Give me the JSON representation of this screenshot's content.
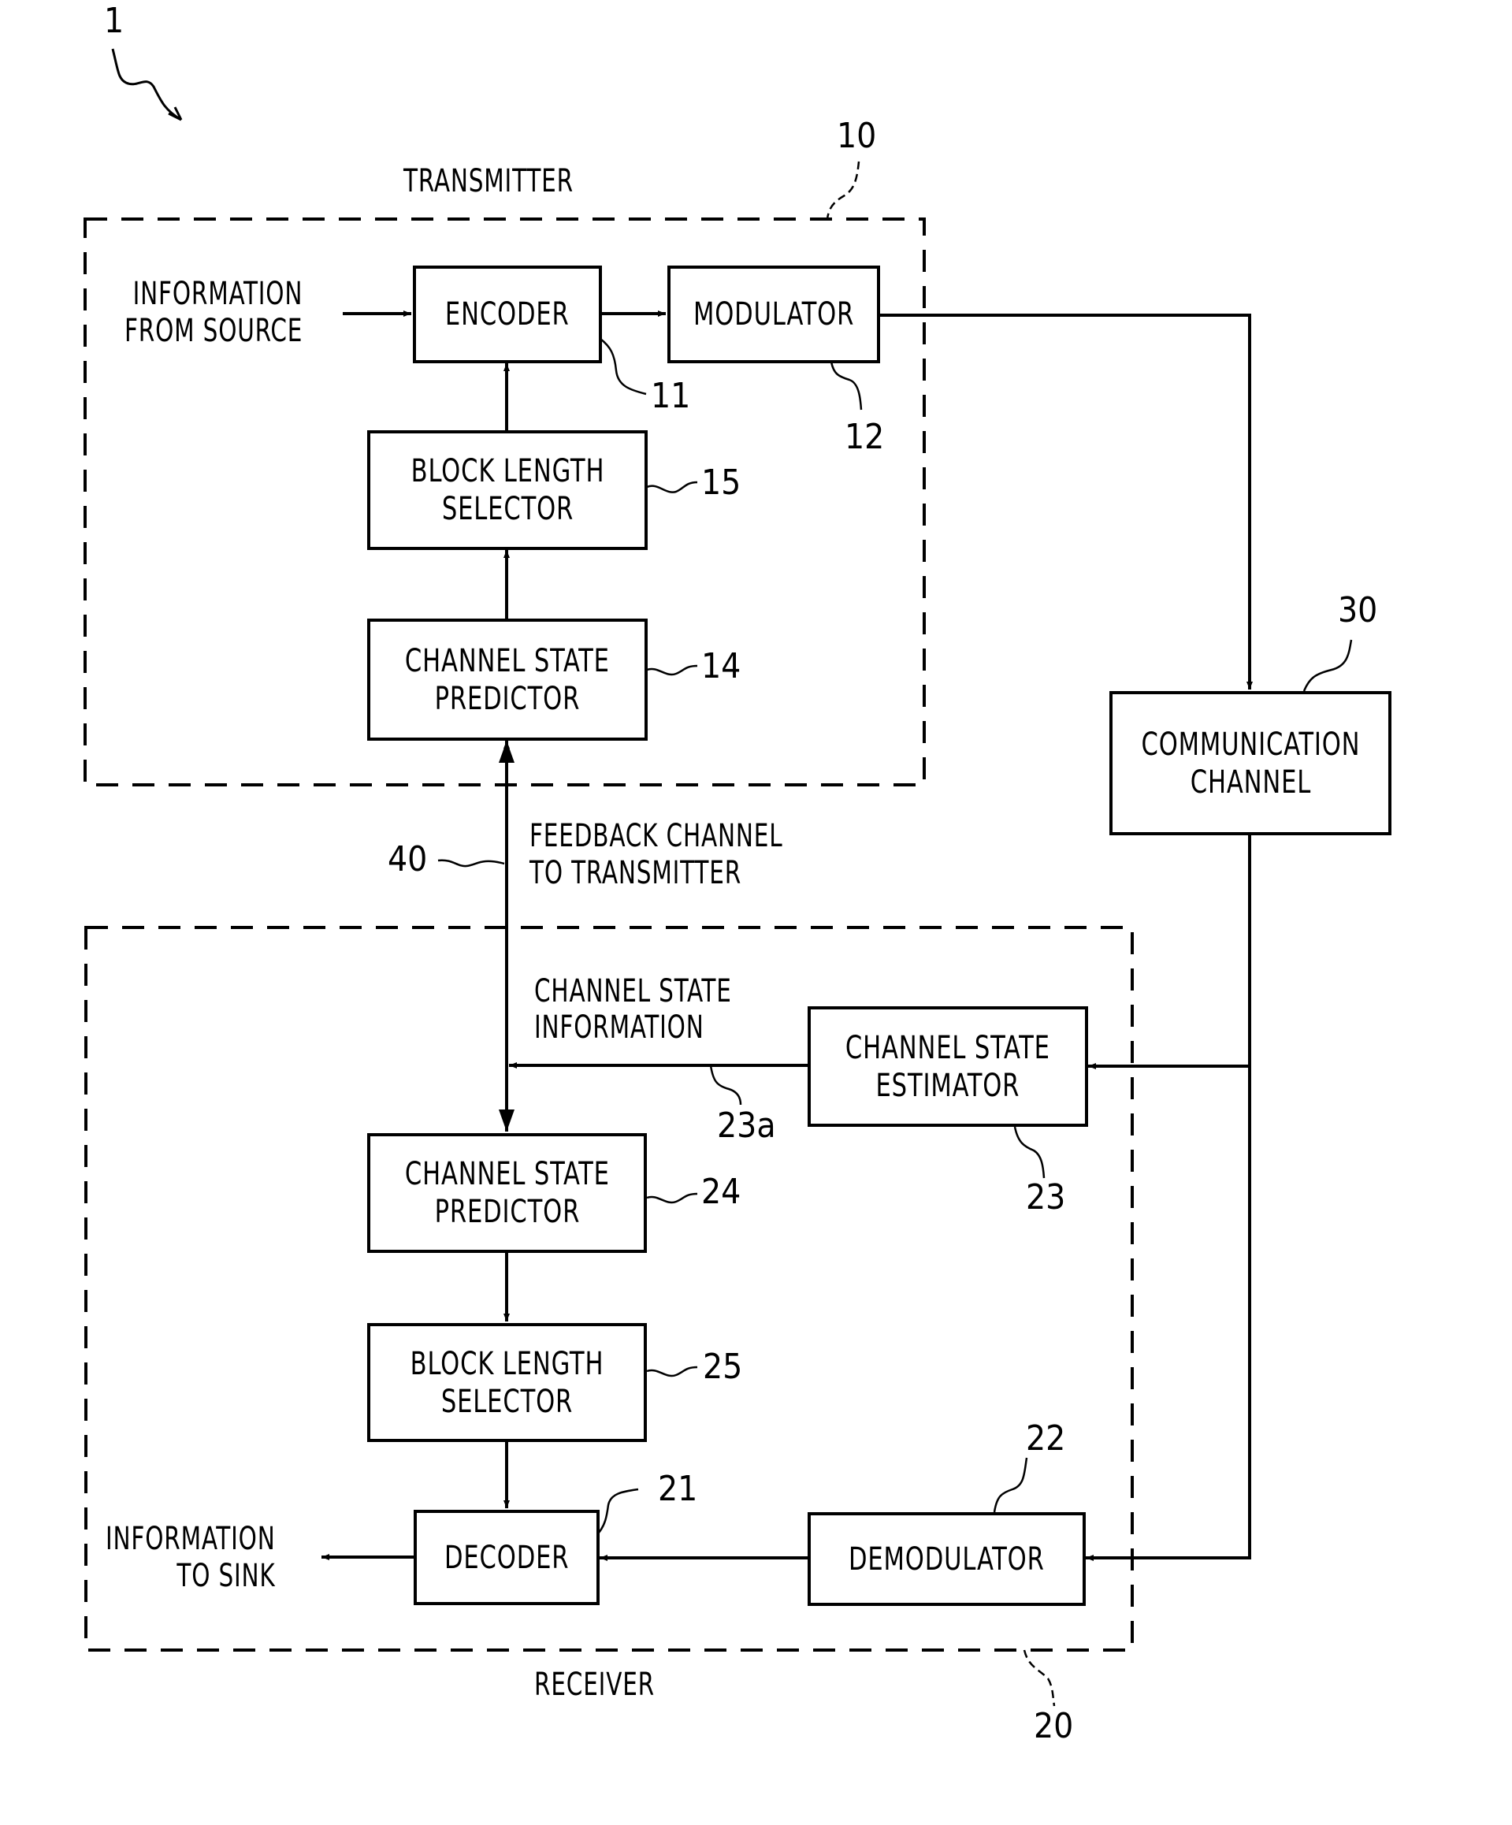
{
  "figure": {
    "system_ref": "1",
    "transmitter": {
      "title": "TRANSMITTER",
      "ref": "10",
      "input_label": "INFORMATION\nFROM SOURCE",
      "blocks": {
        "encoder": {
          "label": "ENCODER",
          "ref": "11"
        },
        "modulator": {
          "label": "MODULATOR",
          "ref": "12"
        },
        "block_length_selector": {
          "label": "BLOCK LENGTH\nSELECTOR",
          "ref": "15"
        },
        "channel_state_predictor": {
          "label": "CHANNEL STATE\nPREDICTOR",
          "ref": "14"
        }
      }
    },
    "communication_channel": {
      "label": "COMMUNICATION\nCHANNEL",
      "ref": "30"
    },
    "feedback_channel": {
      "label": "FEEDBACK CHANNEL\nTO TRANSMITTER",
      "ref": "40"
    },
    "receiver": {
      "title": "RECEIVER",
      "ref": "20",
      "output_label": "INFORMATION\nTO SINK",
      "csi_label": "CHANNEL STATE\nINFORMATION",
      "csi_ref": "23a",
      "blocks": {
        "channel_state_estimator": {
          "label": "CHANNEL STATE\nESTIMATOR",
          "ref": "23"
        },
        "channel_state_predictor": {
          "label": "CHANNEL STATE\nPREDICTOR",
          "ref": "24"
        },
        "block_length_selector": {
          "label": "BLOCK LENGTH\nSELECTOR",
          "ref": "25"
        },
        "decoder": {
          "label": "DECODER",
          "ref": "21"
        },
        "demodulator": {
          "label": "DEMODULATOR",
          "ref": "22"
        }
      }
    }
  }
}
